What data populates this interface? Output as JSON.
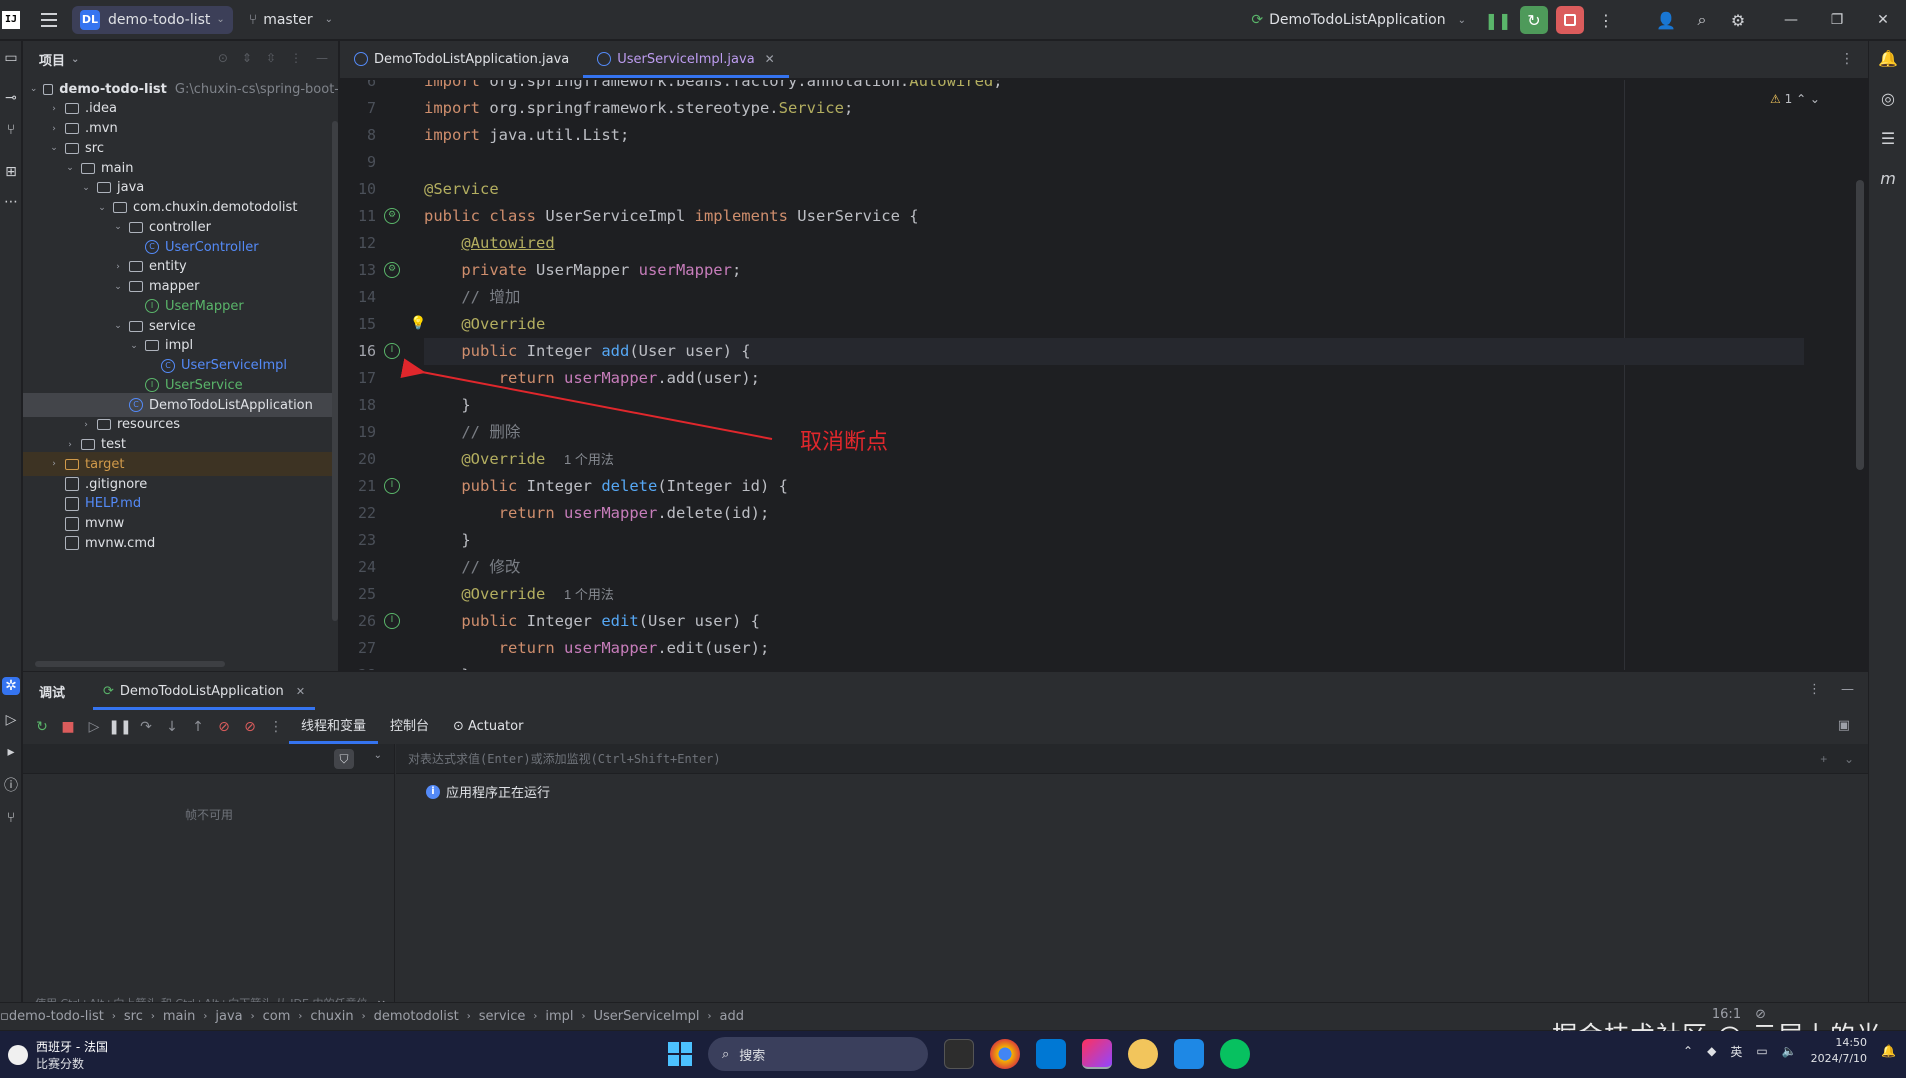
{
  "titlebar": {
    "ide_icon": "IJ",
    "project_badge": "DL",
    "project_name": "demo-todo-list",
    "branch_icon": "git-branch-icon",
    "branch": "master",
    "run_config": "DemoTodoListApplication",
    "accent": "#3574f0"
  },
  "project_panel": {
    "title": "项目",
    "tree": [
      {
        "label": "demo-todo-list",
        "extra": "G:\\chuxin-cs\\spring-boot-",
        "depth": 0,
        "expanded": true,
        "kind": "module"
      },
      {
        "label": ".idea",
        "depth": 1,
        "expanded": false,
        "kind": "folder"
      },
      {
        "label": ".mvn",
        "depth": 1,
        "expanded": false,
        "kind": "folder"
      },
      {
        "label": "src",
        "depth": 1,
        "expanded": true,
        "kind": "folder"
      },
      {
        "label": "main",
        "depth": 2,
        "expanded": true,
        "kind": "folder"
      },
      {
        "label": "java",
        "depth": 3,
        "expanded": true,
        "kind": "folder"
      },
      {
        "label": "com.chuxin.demotodolist",
        "depth": 4,
        "expanded": true,
        "kind": "folder"
      },
      {
        "label": "controller",
        "depth": 5,
        "expanded": true,
        "kind": "folder"
      },
      {
        "label": "UserController",
        "depth": 6,
        "kind": "class"
      },
      {
        "label": "entity",
        "depth": 5,
        "expanded": false,
        "kind": "folder"
      },
      {
        "label": "mapper",
        "depth": 5,
        "expanded": true,
        "kind": "folder"
      },
      {
        "label": "UserMapper",
        "depth": 6,
        "kind": "interface"
      },
      {
        "label": "service",
        "depth": 5,
        "expanded": true,
        "kind": "folder"
      },
      {
        "label": "impl",
        "depth": 6,
        "expanded": true,
        "kind": "folder"
      },
      {
        "label": "UserServiceImpl",
        "depth": 7,
        "kind": "class"
      },
      {
        "label": "UserService",
        "depth": 6,
        "kind": "interface"
      },
      {
        "label": "DemoTodoListApplication",
        "depth": 5,
        "kind": "app",
        "selected": true
      },
      {
        "label": "resources",
        "depth": 3,
        "expanded": false,
        "kind": "folder"
      },
      {
        "label": "test",
        "depth": 2,
        "expanded": false,
        "kind": "folder"
      },
      {
        "label": "target",
        "depth": 1,
        "expanded": false,
        "kind": "folder-excluded"
      },
      {
        "label": ".gitignore",
        "depth": 1,
        "kind": "file"
      },
      {
        "label": "HELP.md",
        "depth": 1,
        "kind": "markdown"
      },
      {
        "label": "mvnw",
        "depth": 1,
        "kind": "file"
      },
      {
        "label": "mvnw.cmd",
        "depth": 1,
        "kind": "file"
      }
    ]
  },
  "editor": {
    "tabs": [
      {
        "label": "DemoTodoListApplication.java",
        "active": false
      },
      {
        "label": "UserServiceImpl.java",
        "active": true
      }
    ],
    "warnings": "1",
    "lines": [
      {
        "n": "6",
        "html": "<span class=\"kw\">import</span> org.springframework.beans.factory.annotation.<span class=\"an\">Autowired</span>;"
      },
      {
        "n": "7",
        "html": "<span class=\"kw\">import</span> org.springframework.stereotype.<span class=\"an\">Service</span>;"
      },
      {
        "n": "8",
        "html": "<span class=\"kw\">import</span> java.util.List;"
      },
      {
        "n": "9",
        "html": ""
      },
      {
        "n": "10",
        "html": "<span class=\"an\">@Service</span>"
      },
      {
        "n": "11",
        "html": "<span class=\"kw\">public class</span> UserServiceImpl <span class=\"kw\">implements</span> UserService {"
      },
      {
        "n": "12",
        "html": "    <span class=\"an u\">@Autowired</span>"
      },
      {
        "n": "13",
        "html": "    <span class=\"kw\">private</span> UserMapper <span class=\"fld\">userMapper</span>;"
      },
      {
        "n": "14",
        "html": "    <span class=\"cm\">// 增加</span>"
      },
      {
        "n": "15",
        "html": "    <span class=\"an\">@Override</span>"
      },
      {
        "n": "16",
        "html": "    <span class=\"kw\">public</span> Integer <span class=\"fn\">add</span>(User user) {"
      },
      {
        "n": "17",
        "html": "        <span class=\"kw\">return</span> <span class=\"fld\">userMapper</span>.add(user);"
      },
      {
        "n": "18",
        "html": "    }"
      },
      {
        "n": "19",
        "html": "    <span class=\"cm\">// 删除</span>"
      },
      {
        "n": "20",
        "html": "    <span class=\"an\">@Override</span>  <span class=\"hint\">1 个用法</span>"
      },
      {
        "n": "21",
        "html": "    <span class=\"kw\">public</span> Integer <span class=\"fn\">delete</span>(Integer id) {"
      },
      {
        "n": "22",
        "html": "        <span class=\"kw\">return</span> <span class=\"fld\">userMapper</span>.delete(id);"
      },
      {
        "n": "23",
        "html": "    }"
      },
      {
        "n": "24",
        "html": "    <span class=\"cm\">// 修改</span>"
      },
      {
        "n": "25",
        "html": "    <span class=\"an\">@Override</span>  <span class=\"hint\">1 个用法</span>"
      },
      {
        "n": "26",
        "html": "    <span class=\"kw\">public</span> Integer <span class=\"fn\">edit</span>(User user) {"
      },
      {
        "n": "27",
        "html": "        <span class=\"kw\">return</span> <span class=\"fld\">userMapper</span>.edit(user);"
      },
      {
        "n": "28",
        "html": "    }"
      }
    ],
    "current_line": "16",
    "annotation": "取消断点",
    "annotation_color": "#e0272c"
  },
  "debug": {
    "title": "调试",
    "run_tab": "DemoTodoListApplication",
    "tabs": [
      "线程和变量",
      "控制台",
      "Actuator"
    ],
    "frames_empty": "帧不可用",
    "frames_tip": "使用 Ctrl+Alt+向上箭头 和 Ctrl+Alt+向下箭头 从 IDE 中的任意位...",
    "eval_placeholder": "对表达式求值(Enter)或添加监视(Ctrl+Shift+Enter)",
    "status": "应用程序正在运行"
  },
  "statusbar": {
    "breadcrumbs": [
      "demo-todo-list",
      "src",
      "main",
      "java",
      "com",
      "chuxin",
      "demotodolist",
      "service",
      "impl",
      "UserServiceImpl",
      "add"
    ],
    "position": "16:1",
    "watermark": "掘金技术社区 @ 云层上的光"
  },
  "taskbar": {
    "news_title": "西班牙 - 法国",
    "news_sub": "比赛分数",
    "search": "搜索",
    "ime": "英",
    "clock_time": "14:50",
    "clock_date": "2024/7/10"
  }
}
